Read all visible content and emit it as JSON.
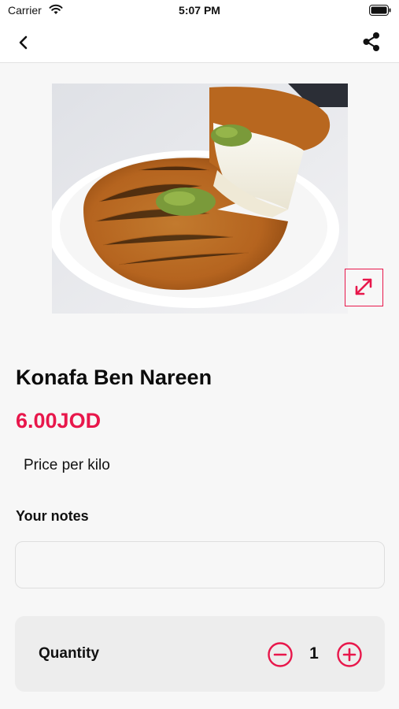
{
  "status_bar": {
    "carrier": "Carrier",
    "time": "5:07 PM",
    "icons": [
      "wifi-icon",
      "battery-icon"
    ]
  },
  "nav": {
    "back_icon": "chevron-left-icon",
    "share_icon": "share-icon"
  },
  "product": {
    "image_alt": "Konafa",
    "expand_icon": "expand-icon",
    "title": "Konafa Ben Nareen",
    "price": "6.00JOD",
    "price_unit": "Price per kilo"
  },
  "notes": {
    "label": "Your notes",
    "value": "",
    "placeholder": ""
  },
  "quantity": {
    "label": "Quantity",
    "value": "1",
    "minus_icon": "minus-circle-icon",
    "plus_icon": "plus-circle-icon"
  },
  "colors": {
    "accent": "#e8174b",
    "background": "#f7f7f7",
    "panel": "#ededed"
  }
}
